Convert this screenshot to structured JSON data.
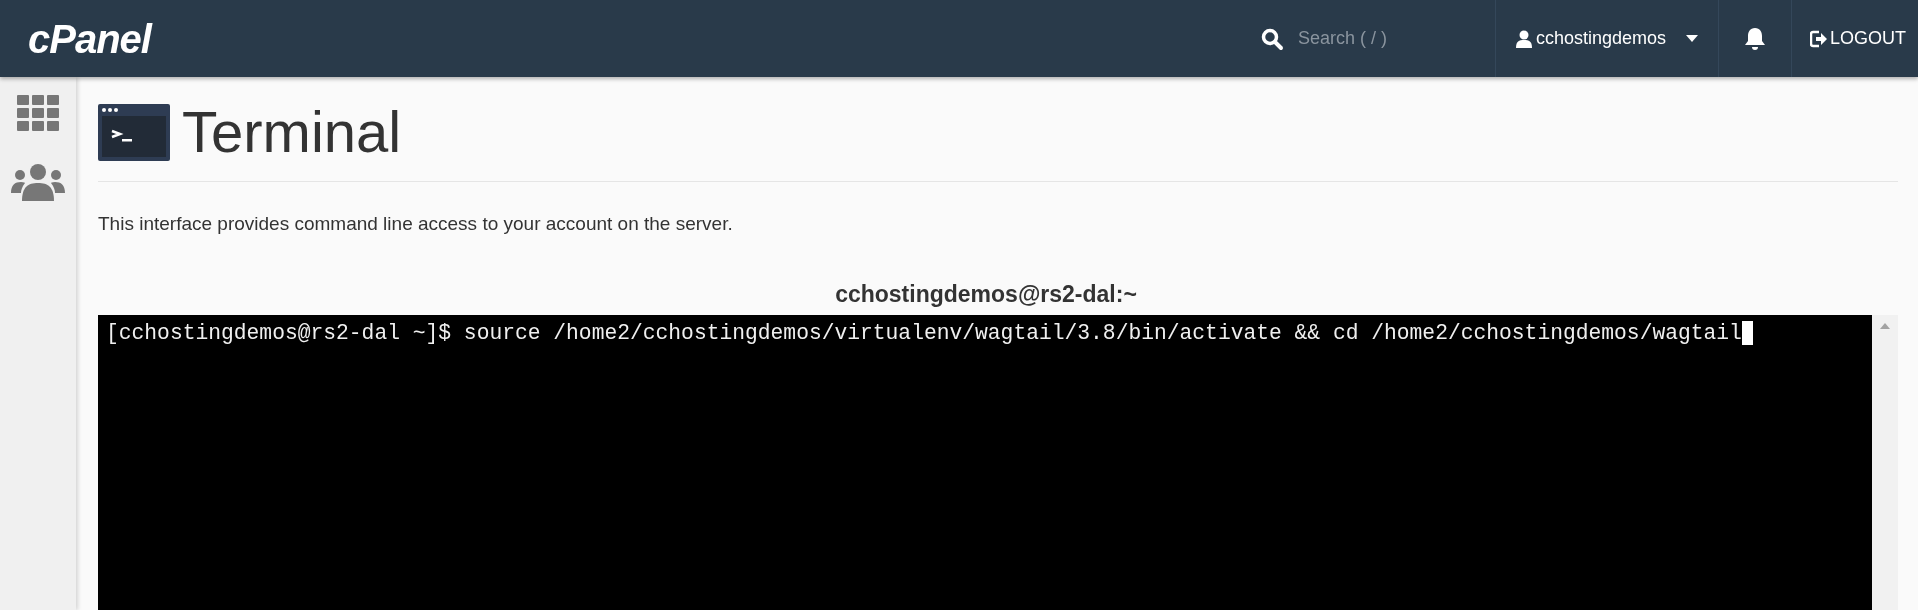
{
  "header": {
    "logo": "cPanel",
    "search": {
      "placeholder": "Search ( / )"
    },
    "user": "cchostingdemos",
    "logout": "LOGOUT"
  },
  "sidebar": {
    "items": [
      {
        "kind": "grid"
      },
      {
        "kind": "users"
      }
    ]
  },
  "page": {
    "title": "Terminal",
    "description": "This interface provides command line access to your account on the server."
  },
  "terminal": {
    "title": "cchostingdemos@rs2-dal:~",
    "lines": [
      "[cchostingdemos@rs2-dal ~]$ source /home2/cchostingdemos/virtualenv/wagtail/3.8/bin/activate && cd /home2/cchostingdemos/wagtail"
    ]
  }
}
